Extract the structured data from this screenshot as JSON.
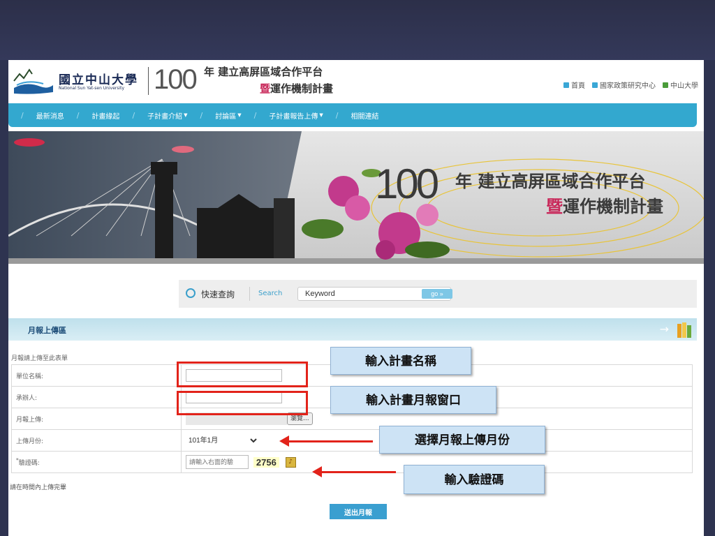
{
  "header": {
    "logo_zh": "國立中山大學",
    "logo_en": "National Sun Yat-sen University",
    "year_number": "100",
    "title_line1": "年 建立高屏區域合作平台",
    "title_line2_highlight": "暨",
    "title_line2_rest": "運作機制計畫",
    "top_links": [
      "首頁",
      "國家政策研究中心",
      "中山大學"
    ]
  },
  "nav": {
    "items": [
      {
        "label": "最新消息",
        "has_dropdown": false
      },
      {
        "label": "計畫緣起",
        "has_dropdown": false
      },
      {
        "label": "子計畫介紹",
        "has_dropdown": true
      },
      {
        "label": "討論區",
        "has_dropdown": true
      },
      {
        "label": "子計畫報告上傳",
        "has_dropdown": true
      },
      {
        "label": "相關連結",
        "has_dropdown": false
      }
    ]
  },
  "banner": {
    "year_number": "100",
    "title_line1": "年 建立高屏區域合作平台",
    "title_line2_highlight": "暨",
    "title_line2_rest": "運作機制計畫"
  },
  "search": {
    "label": "快速查詢",
    "search_label": "Search",
    "value": "Keyword",
    "go_label": "go »"
  },
  "section": {
    "title": "月報上傳區"
  },
  "form": {
    "hint": "月報請上傳至此表單",
    "rows": {
      "unit_label": "單位名稱:",
      "contact_label": "承辦人:",
      "upload_label": "月報上傳:",
      "browse_label": "瀏覽...",
      "month_label": "上傳月份:",
      "month_value": "101年1月",
      "captcha_label": "驗證碼:",
      "captcha_required": "*",
      "captcha_placeholder": "請輸入右面的驗",
      "captcha_code": "2756"
    },
    "note": "請在時間內上傳完畢",
    "submit_label": "送出月報"
  },
  "annotations": {
    "callout_plan_name": "輸入計畫名稱",
    "callout_contact": "輸入計畫月報窗口",
    "callout_month": "選擇月報上傳月份",
    "callout_captcha": "輸入驗證碼"
  },
  "colors": {
    "nav_bg": "#33a8cf",
    "highlight": "#c8285a",
    "annotation_red": "#e2231a",
    "callout_bg": "#cde3f5",
    "slide_bg": "#2e3350"
  }
}
